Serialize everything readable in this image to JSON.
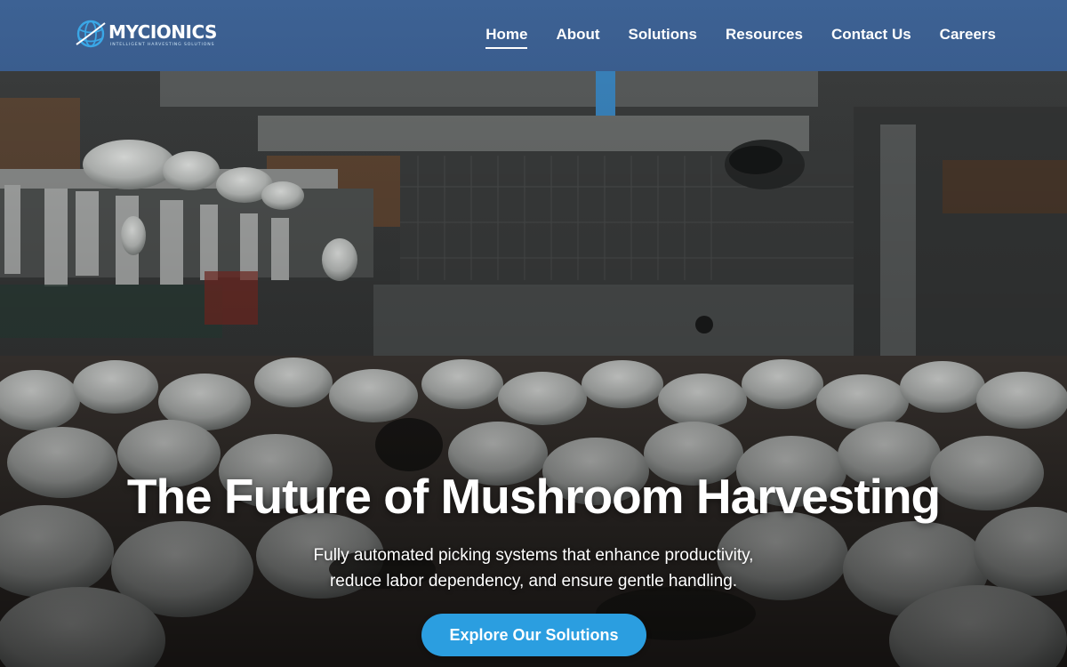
{
  "brand": {
    "name": "MYCIONICS",
    "tagline": "INTELLIGENT HARVESTING SOLUTIONS",
    "logo_icon": "globe-icon"
  },
  "nav": {
    "items": [
      {
        "label": "Home",
        "active": true
      },
      {
        "label": "About",
        "active": false
      },
      {
        "label": "Solutions",
        "active": false
      },
      {
        "label": "Resources",
        "active": false
      },
      {
        "label": "Contact Us",
        "active": false
      },
      {
        "label": "Careers",
        "active": false
      }
    ]
  },
  "hero": {
    "title": "The Future of Mushroom Harvesting",
    "subtitle_line1": "Fully automated picking systems that enhance productivity,",
    "subtitle_line2": "reduce labor dependency, and ensure gentle handling.",
    "cta_label": "Explore Our Solutions",
    "background": "mushroom-harvesting-robot-photo"
  },
  "colors": {
    "header_bg": "#3b5f90",
    "cta_bg": "#2b9ee0",
    "text": "#ffffff",
    "logo_accent": "#3aa7e6"
  }
}
